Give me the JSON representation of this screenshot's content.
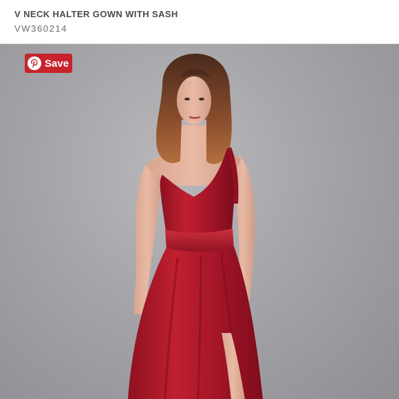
{
  "product": {
    "title": "V NECK HALTER GOWN WITH SASH",
    "sku": "VW360214"
  },
  "save_button": {
    "label": "Save",
    "icon": "pinterest-icon",
    "color": "#c8232c"
  },
  "photo": {
    "description_icon": "model-photo",
    "dress_color": "#b3182a",
    "background_color": "#a5a4a8"
  }
}
